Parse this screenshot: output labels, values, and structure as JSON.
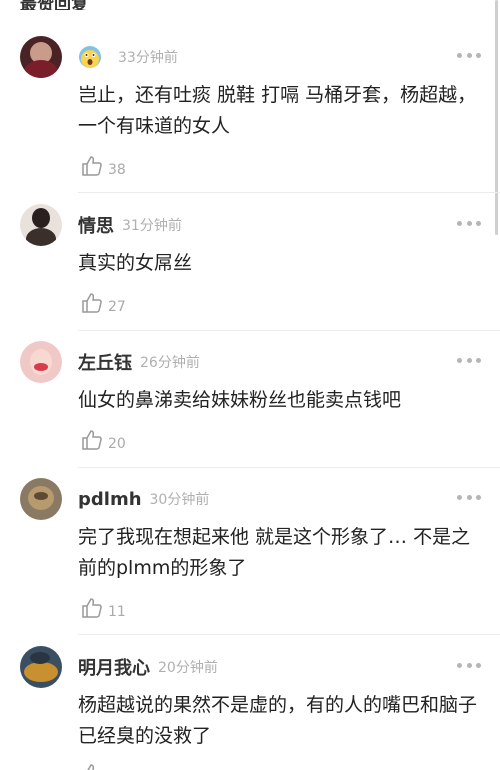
{
  "section": {
    "title": "最赞回复"
  },
  "comments": [
    {
      "username": "",
      "name_icon": "screaming-face-emoji-icon",
      "time": "33分钟前",
      "text": "岂止，还有吐痰 脱鞋 打嗝 马桶牙套，杨超越，一个有味道的女人",
      "likes": "38"
    },
    {
      "username": "情思",
      "time": "31分钟前",
      "text": "真实的女屌丝",
      "likes": "27"
    },
    {
      "username": "左丘钰",
      "time": "26分钟前",
      "text": "仙女的鼻涕卖给妹妹粉丝也能卖点钱吧",
      "likes": "20"
    },
    {
      "username": "pdlmh",
      "time": "30分钟前",
      "text": "完了我现在想起来他 就是这个形象了… 不是之前的plmm的形象了",
      "likes": "11"
    },
    {
      "username": "明月我心",
      "time": "20分钟前",
      "text": "杨超越说的果然不是虚的，有的人的嘴巴和脑子已经臭的没救了",
      "likes": ""
    }
  ],
  "colors": {
    "text": "#222222",
    "meta": "#b0b0b0",
    "divider": "#ececec"
  }
}
